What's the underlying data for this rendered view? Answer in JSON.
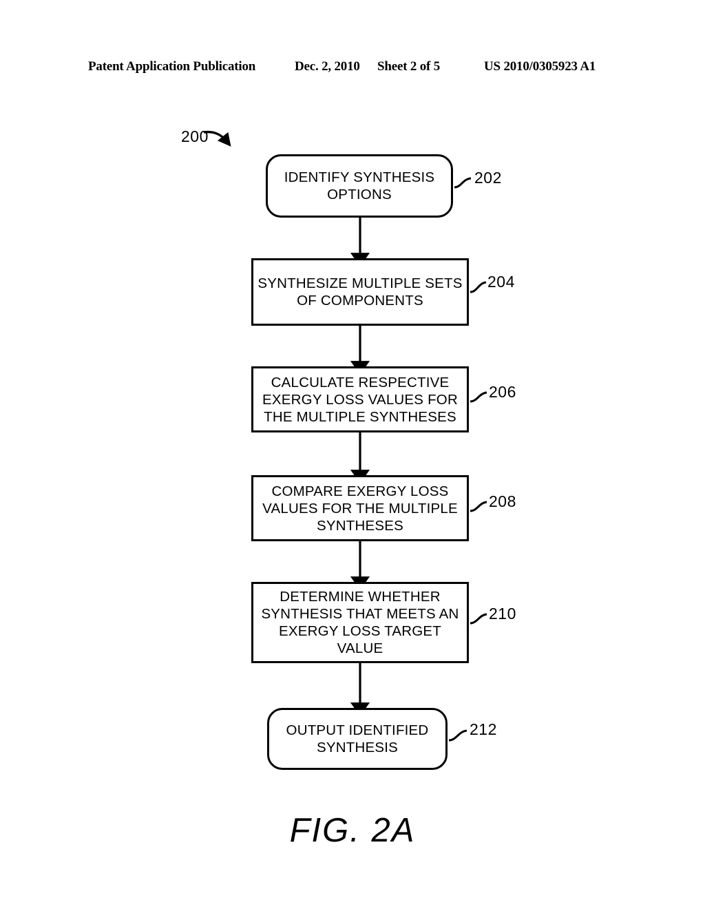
{
  "header": {
    "publication": "Patent Application Publication",
    "date": "Dec. 2, 2010",
    "sheet": "Sheet 2 of 5",
    "patent_number": "US 2010/0305923 A1"
  },
  "figure": {
    "caption": "FIG. 2A",
    "diagram_label": "200",
    "nodes": [
      {
        "ref": "202",
        "text": "IDENTIFY SYNTHESIS\nOPTIONS",
        "shape": "rounded-rectangle"
      },
      {
        "ref": "204",
        "text": "SYNTHESIZE MULTIPLE SETS\nOF COMPONENTS",
        "shape": "rectangle"
      },
      {
        "ref": "206",
        "text": "CALCULATE RESPECTIVE\nEXERGY LOSS VALUES FOR\nTHE MULTIPLE SYNTHESES",
        "shape": "rectangle"
      },
      {
        "ref": "208",
        "text": "COMPARE EXERGY LOSS\nVALUES FOR THE MULTIPLE\nSYNTHESES",
        "shape": "rectangle"
      },
      {
        "ref": "210",
        "text": "DETERMINE WHETHER\nSYNTHESIS THAT MEETS AN\nEXERGY LOSS TARGET\nVALUE",
        "shape": "rectangle"
      },
      {
        "ref": "212",
        "text": "OUTPUT IDENTIFIED\nSYNTHESIS",
        "shape": "rounded-rectangle"
      }
    ]
  }
}
